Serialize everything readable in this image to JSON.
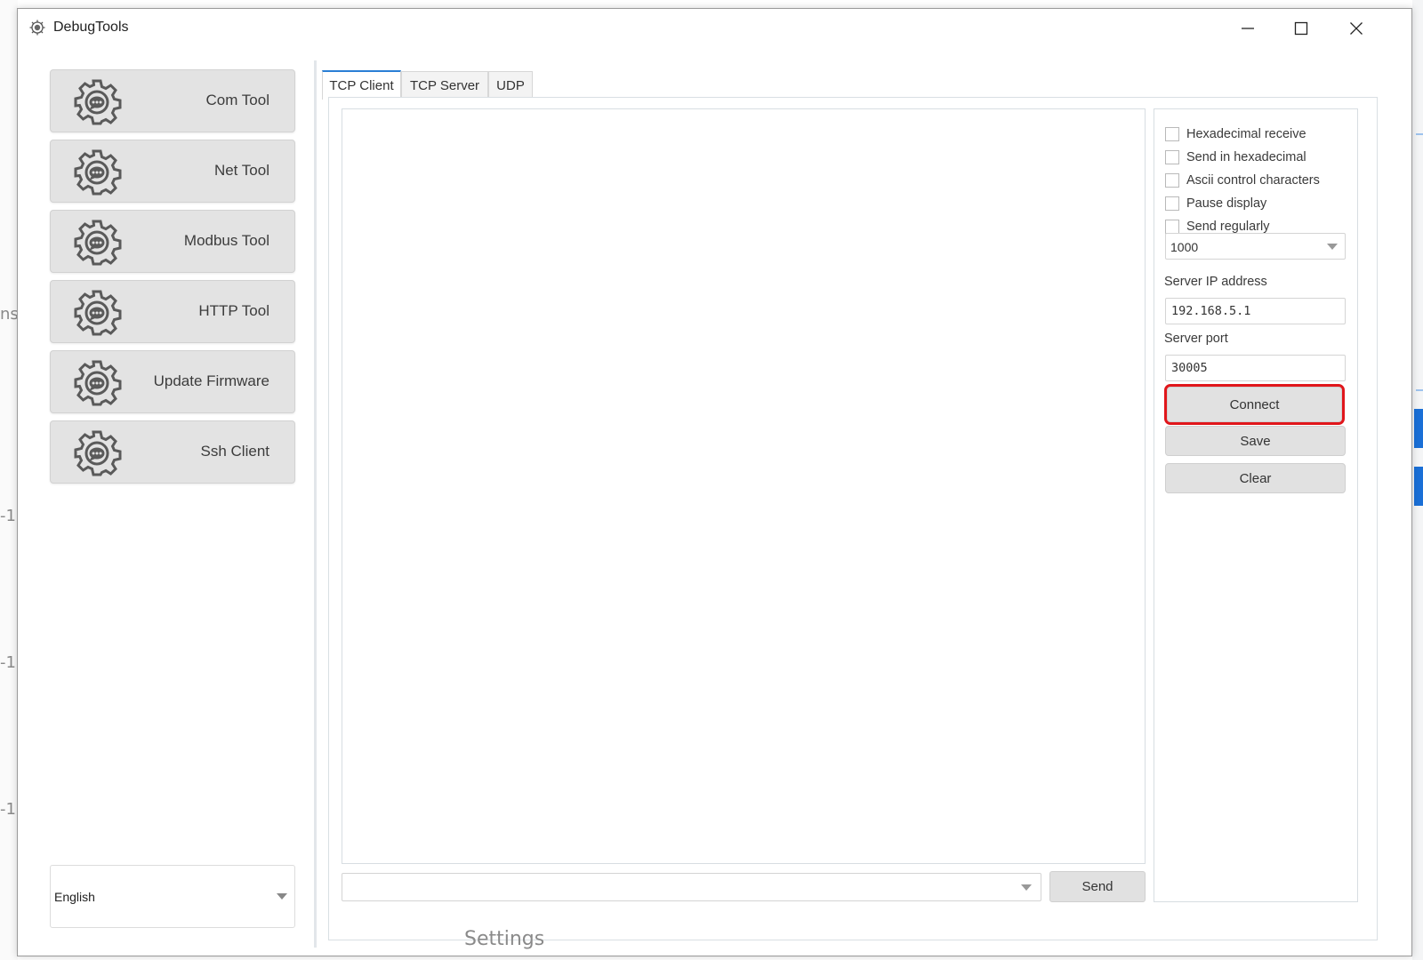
{
  "window": {
    "title": "DebugTools",
    "icon": "gear-chat-icon",
    "controls": [
      "minimize-icon",
      "maximize-icon",
      "close-icon"
    ]
  },
  "background": {
    "left_fragments": [
      "ns",
      "-1",
      "-1",
      "-1"
    ],
    "bottom_fragment": "Settings"
  },
  "sidebar": {
    "items": [
      {
        "label": "Com Tool",
        "icon": "gear-chat-icon"
      },
      {
        "label": "Net Tool",
        "icon": "gear-chat-icon"
      },
      {
        "label": "Modbus Tool",
        "icon": "gear-chat-icon"
      },
      {
        "label": "HTTP Tool",
        "icon": "gear-chat-icon"
      },
      {
        "label": "Update Firmware",
        "icon": "gear-chat-icon"
      },
      {
        "label": "Ssh Client",
        "icon": "gear-chat-icon"
      }
    ],
    "language": "English"
  },
  "tabs": [
    {
      "label": "TCP Client",
      "active": true
    },
    {
      "label": "TCP Server",
      "active": false
    },
    {
      "label": "UDP",
      "active": false
    }
  ],
  "main": {
    "send_input_value": "",
    "send_button": "Send"
  },
  "settings": {
    "checkboxes": [
      {
        "label": "Hexadecimal receive",
        "checked": false
      },
      {
        "label": "Send in hexadecimal",
        "checked": false
      },
      {
        "label": "Ascii control characters",
        "checked": false
      },
      {
        "label": "Pause display",
        "checked": false
      },
      {
        "label": "Send regularly",
        "checked": false
      }
    ],
    "interval": "1000",
    "server_ip_label": "Server IP address",
    "server_ip": "192.168.5.1",
    "server_port_label": "Server port",
    "server_port": "30005",
    "connect_button": "Connect",
    "save_button": "Save",
    "clear_button": "Clear"
  },
  "colors": {
    "accent": "#2a7fd5",
    "highlight": "#e0161b",
    "button_bg": "#e1e1e1"
  }
}
